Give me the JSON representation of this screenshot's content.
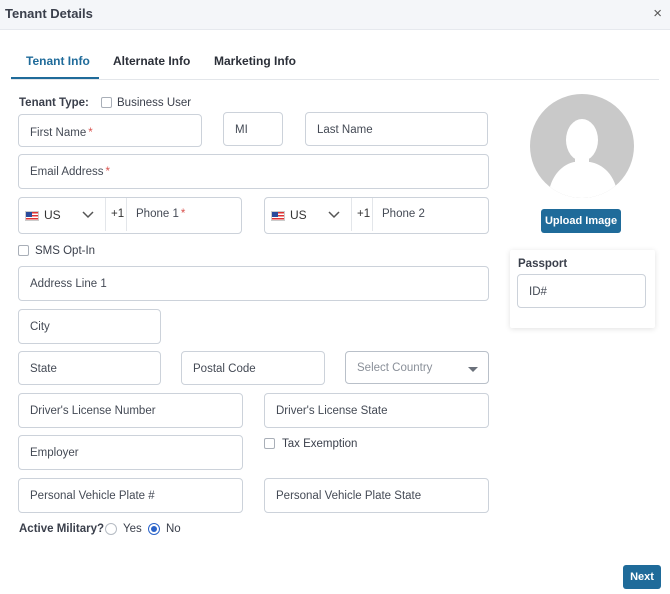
{
  "dialog": {
    "title": "Tenant Details",
    "close": "×"
  },
  "tabs": [
    {
      "label": "Tenant Info",
      "active": true
    },
    {
      "label": "Alternate Info"
    },
    {
      "label": "Marketing Info"
    }
  ],
  "tenant_type": {
    "label": "Tenant Type:",
    "business_user": "Business User"
  },
  "fields": {
    "first_name": "First Name",
    "mi": "MI",
    "last_name": "Last Name",
    "email": "Email Address",
    "phone1": "Phone 1",
    "phone2": "Phone 2",
    "address1": "Address Line 1",
    "city": "City",
    "state": "State",
    "postal_code": "Postal Code",
    "country": "Select Country",
    "dl_number": "Driver's License Number",
    "dl_state": "Driver's License State",
    "employer": "Employer",
    "plate": "Personal Vehicle Plate #",
    "plate_state": "Personal Vehicle Plate State",
    "passport_id": "ID#"
  },
  "required_mark": "*",
  "phone": {
    "country": "US",
    "code": "+1",
    "chevron": "⌄"
  },
  "checkboxes": {
    "sms_opt_in": "SMS Opt-In",
    "tax_exemption": "Tax Exemption"
  },
  "passport": {
    "label": "Passport"
  },
  "buttons": {
    "upload_image": "Upload Image",
    "next": "Next"
  },
  "military": {
    "label": "Active Military?",
    "yes": "Yes",
    "no": "No",
    "selected": "No"
  },
  "colors": {
    "accent": "#1f6b9a",
    "radio": "#2a63c9",
    "required": "#d9534f"
  }
}
